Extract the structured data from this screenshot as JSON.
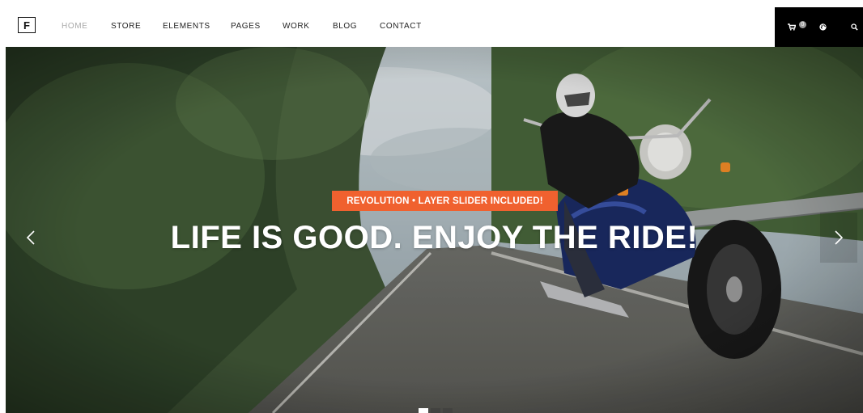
{
  "logo": {
    "letter": "F"
  },
  "nav": {
    "items": [
      {
        "label": "HOME",
        "active": true
      },
      {
        "label": "STORE"
      },
      {
        "label": "ELEMENTS"
      },
      {
        "label": "PAGES"
      },
      {
        "label": "WORK"
      },
      {
        "label": "BLOG"
      },
      {
        "label": "CONTACT"
      }
    ]
  },
  "utility": {
    "cart_count": "0",
    "icons": [
      "cart-icon",
      "globe-icon",
      "search-icon"
    ]
  },
  "hero": {
    "eyebrow": "REVOLUTION • LAYER SLIDER INCLUDED!",
    "headline": "LIFE IS GOOD. ENJOY THE RIDE!",
    "slide_count": 3,
    "active_slide": 1,
    "prev_icon": "chevron-left-icon",
    "next_icon": "chevron-right-icon"
  },
  "colors": {
    "accent": "#f0612f",
    "nav_active": "#a9a9a9",
    "utility_bar": "#000000"
  }
}
